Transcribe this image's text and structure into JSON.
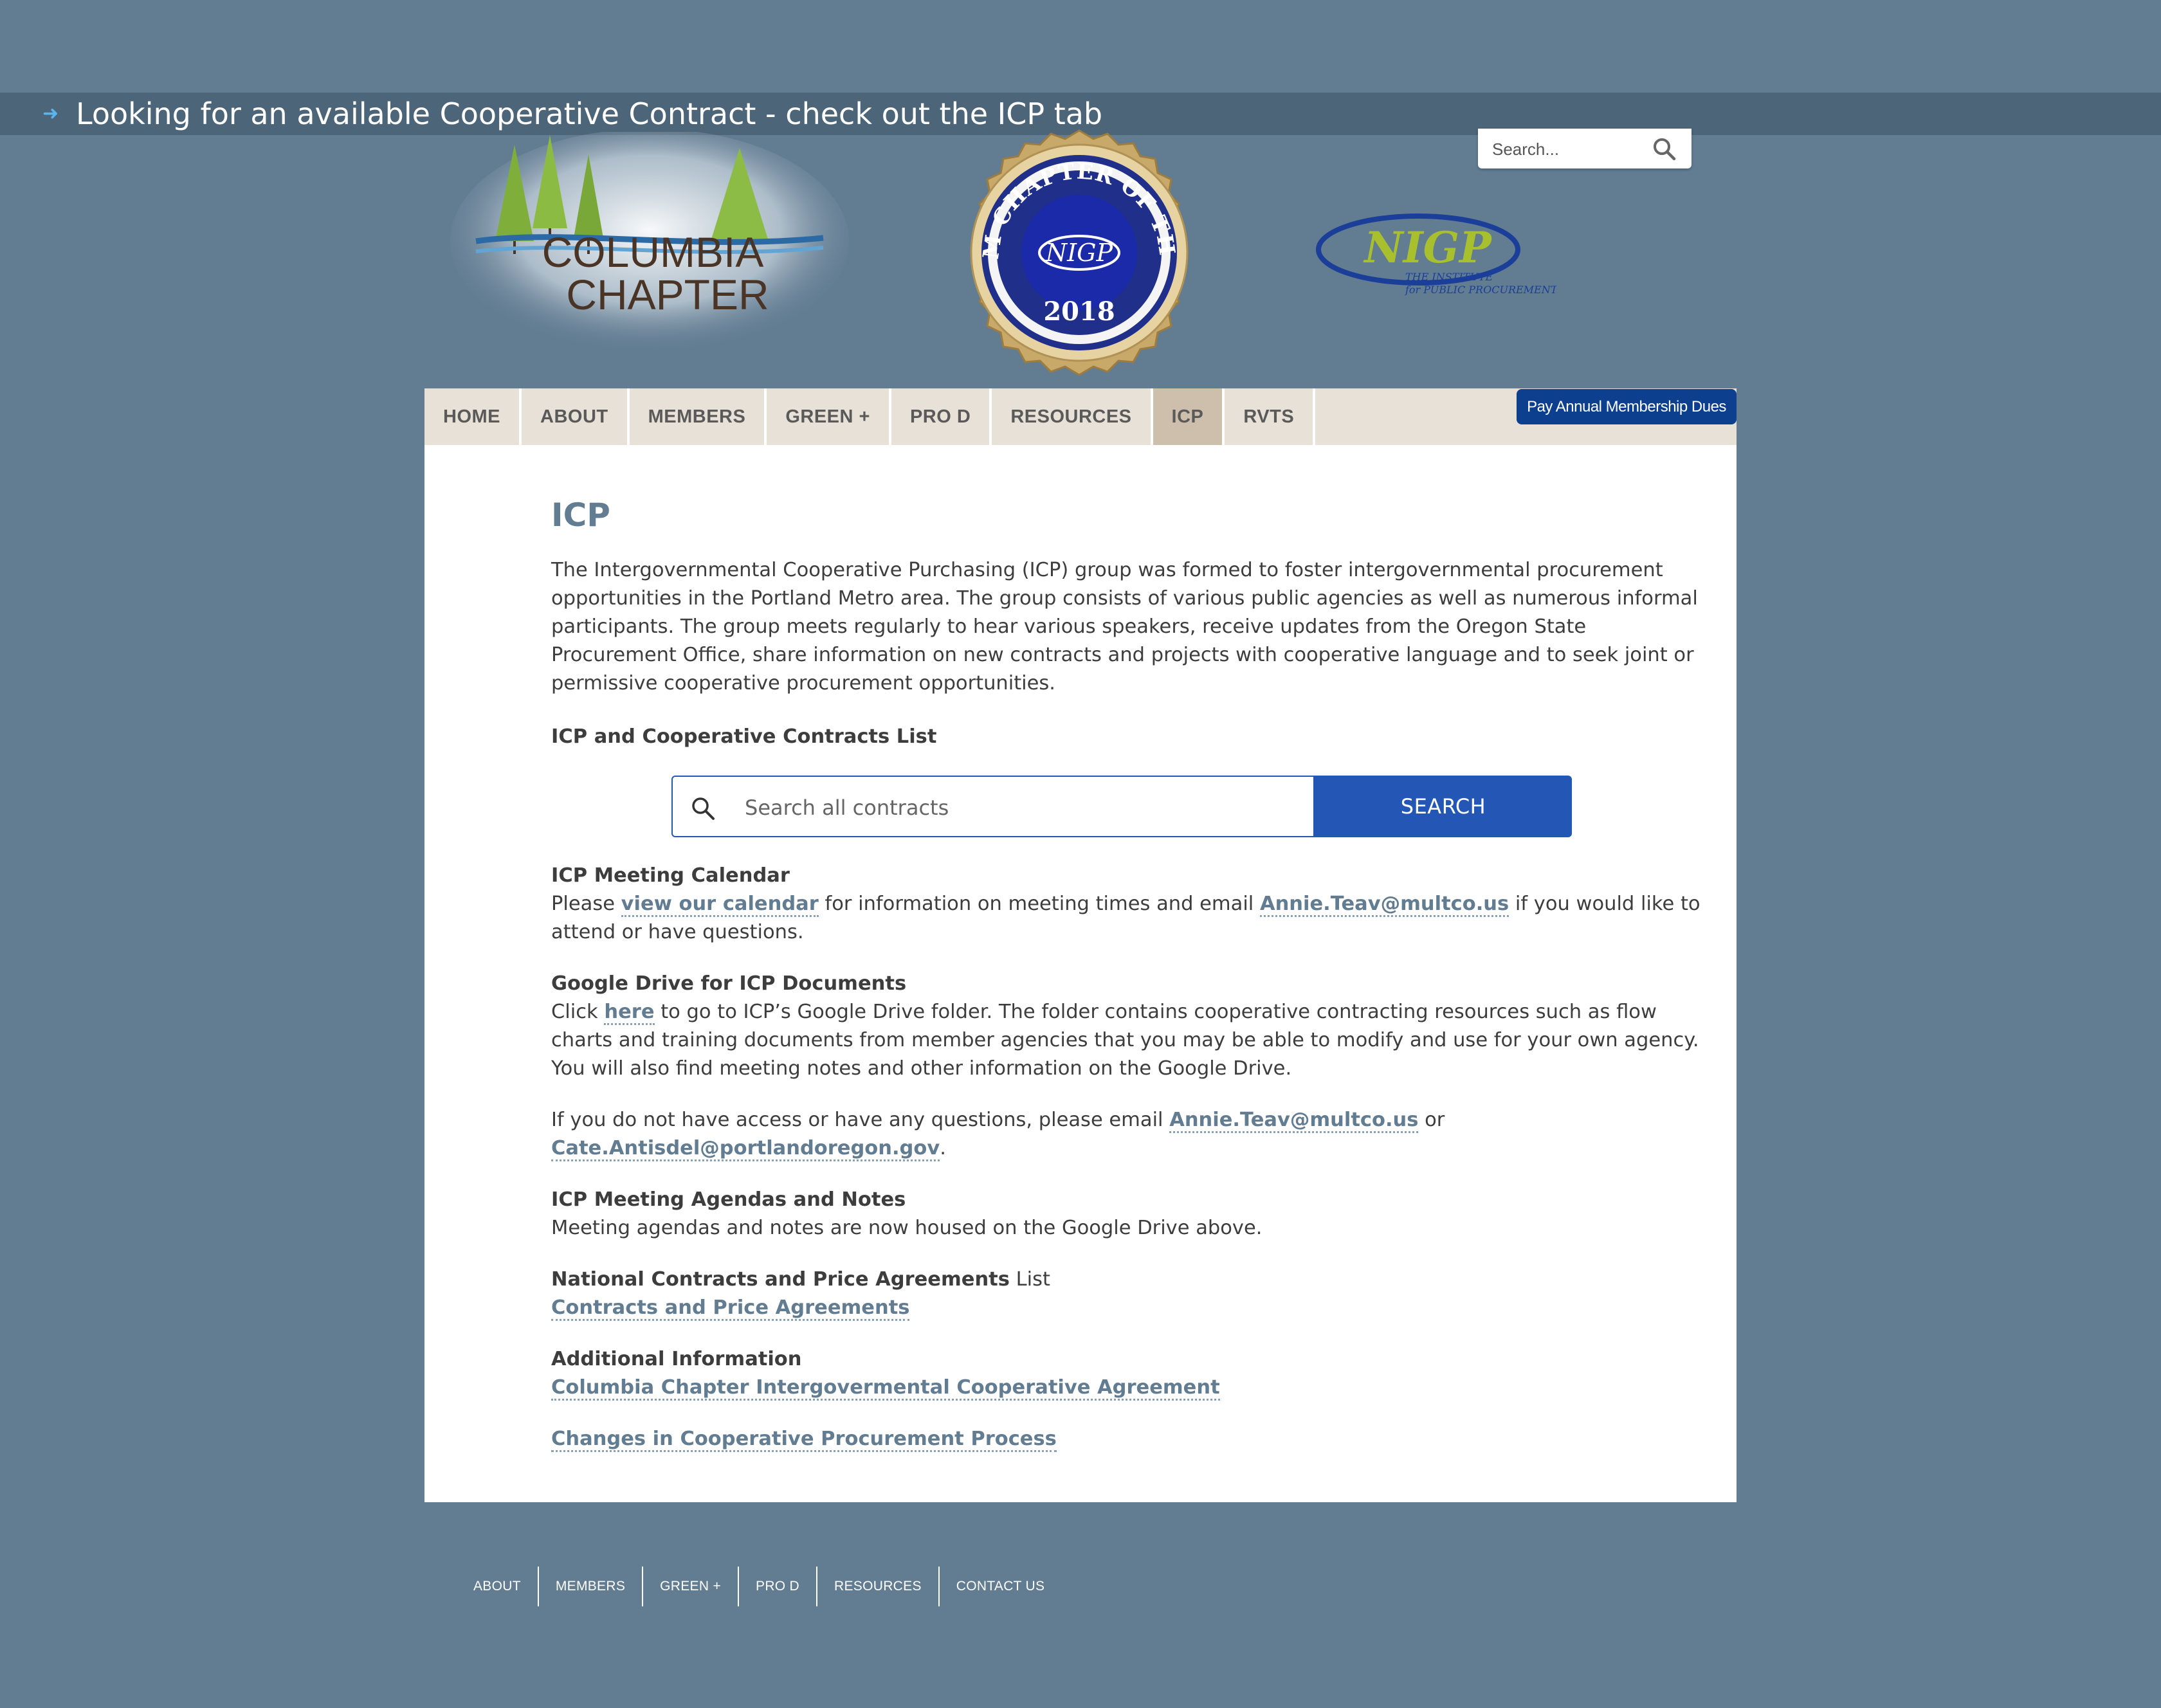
{
  "ticker": {
    "text": "Looking for an available Cooperative Contract - check out the ICP tab",
    "arrow_icon": "arrow-right-icon"
  },
  "top_search": {
    "placeholder": "Search..."
  },
  "logos": {
    "columbia": {
      "line1": "COLUMBIA",
      "line2": "CHAPTER"
    },
    "seal": {
      "arc_text": "MEDIUM CHAPTER OF THE YEAR",
      "center": "NIGP",
      "year": "2018"
    },
    "nigp": {
      "name": "NIGP",
      "sub1": "THE INSTITUTE",
      "sub2": "for PUBLIC PROCUREMENT"
    }
  },
  "nav": {
    "items": [
      "HOME",
      "ABOUT",
      "MEMBERS",
      "GREEN +",
      "PRO D",
      "RESOURCES",
      "ICP",
      "RVTS"
    ],
    "active": "ICP",
    "pay_button": "Pay Annual Membership Dues"
  },
  "main": {
    "title": "ICP",
    "intro": "The Intergovernmental Cooperative Purchasing (ICP) group was formed to foster intergovernmental procurement opportunities in the Portland Metro area.  The group consists of various public agencies as well as numerous informal participants.  The group meets regularly to hear various speakers, receive updates from the Oregon State Procurement Office, share information on new contracts and projects with cooperative language and to seek joint or permissive cooperative procurement opportunities.",
    "contracts_list_heading": "ICP and Cooperative Contracts List",
    "contracts_search": {
      "placeholder": "Search all contracts",
      "button": "SEARCH"
    },
    "calendar": {
      "heading": "ICP Meeting Calendar",
      "pre": "Please ",
      "link": "view our calendar",
      "mid": " for information on meeting times and email ",
      "email": "Annie.Teav@multco.us",
      "post": " if you would like to attend or have questions."
    },
    "drive": {
      "heading": "Google Drive for ICP Documents",
      "pre": "Click ",
      "link": "here",
      "post": " to go to ICP’s Google Drive folder.  The folder contains cooperative contracting resources such as flow charts and training documents from member agencies that you may be able to modify and use for your own agency.  You will also find meeting notes and other information on the Google Drive."
    },
    "access": {
      "pre": "If you do not have access or have any questions, please email ",
      "email1": "Annie.Teav@multco.us",
      "mid": " or ",
      "email2": "Cate.Antisdel@portlandoregon.gov",
      "post": "."
    },
    "agendas": {
      "heading": "ICP Meeting Agendas and Notes",
      "text": "Meeting agendas and notes are now housed on the Google Drive above."
    },
    "national": {
      "heading": "National Contracts and Price Agreements",
      "suffix": " List",
      "link": "Contracts and Price Agreements"
    },
    "additional": {
      "heading": "Additional Information",
      "link": "Columbia Chapter Intergovermental Cooperative Agreement"
    },
    "changes_link": "Changes in Cooperative Procurement Process"
  },
  "footer": {
    "items": [
      "ABOUT",
      "MEMBERS",
      "GREEN +",
      "PRO D",
      "RESOURCES",
      "CONTACT US"
    ]
  },
  "colors": {
    "background": "#627c92",
    "ticker": "#4c6579",
    "nav": "#e8e1d7",
    "nav_active": "#cebfac",
    "pay_button": "#0d3f8f",
    "search_button": "#2456b6",
    "link": "#627c92"
  }
}
